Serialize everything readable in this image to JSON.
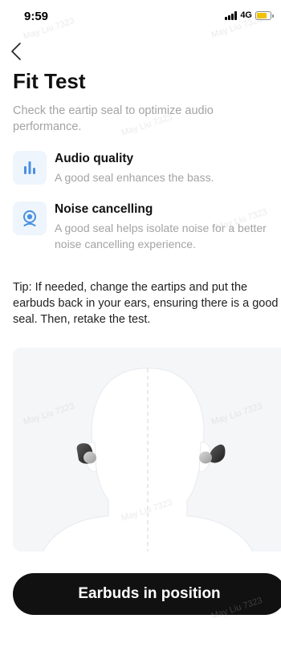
{
  "status_bar": {
    "time": "9:59",
    "network": "4G",
    "battery_level": 0.75
  },
  "header": {
    "back_icon": "chevron-left-icon",
    "title": "Fit Test"
  },
  "description": "Check the eartip seal to optimize audio performance.",
  "features": [
    {
      "icon": "audio-quality-icon",
      "title": "Audio quality",
      "description": "A good seal enhances the bass."
    },
    {
      "icon": "noise-cancelling-icon",
      "title": "Noise cancelling",
      "description": "A good seal helps isolate noise for a better noise cancelling experience."
    }
  ],
  "tip": "Tip: If needed, change the eartips and put the earbuds back in your ears, ensuring there is a good seal. Then, retake the test.",
  "primary_button": {
    "label": "Earbuds in position"
  },
  "watermark": "May Liu 7323",
  "colors": {
    "accent": "#4a90e2",
    "icon_background": "#eef5fc",
    "button": "#111111",
    "muted_text": "#a3a3a3",
    "battery": "#f2c200"
  }
}
